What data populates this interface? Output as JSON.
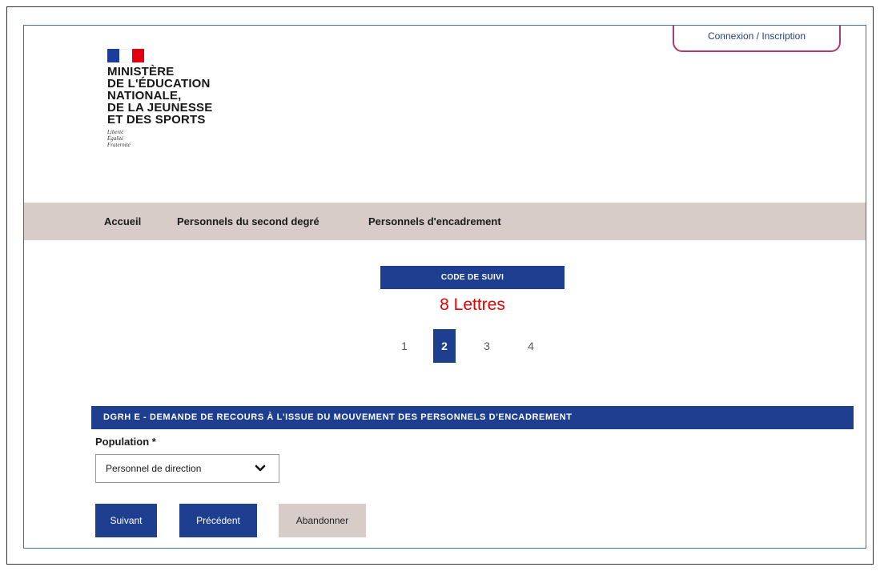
{
  "header": {
    "login_label": "Connexion / Inscription",
    "ministry_lines": [
      "MINISTÈRE",
      "DE L'ÉDUCATION",
      "NATIONALE,",
      "DE LA JEUNESSE",
      "ET DES SPORTS"
    ],
    "motto_lines": [
      "Liberté",
      "Égalité",
      "Fraternité"
    ],
    "flag_colors": {
      "blue": "#1b3d9c",
      "white": "#ffffff",
      "red": "#e1000f"
    }
  },
  "nav": {
    "items": [
      {
        "label": "Accueil"
      },
      {
        "label": "Personnels du second degré"
      },
      {
        "label": "Personnels d'encadrement"
      }
    ]
  },
  "tracking": {
    "label": "CODE DE SUIVI",
    "note": "8 Lettres"
  },
  "stepper": {
    "steps": [
      "1",
      "2",
      "3",
      "4"
    ],
    "active_step": "2"
  },
  "form": {
    "section_title": "DGRH E - DEMANDE DE RECOURS À L'ISSUE DU MOUVEMENT DES PERSONNELS D'ENCADREMENT",
    "population_label": "Population *",
    "population_value": "Personnel de direction"
  },
  "actions": {
    "next_label": "Suivant",
    "previous_label": "Précédent",
    "abandon_label": "Abandonner"
  },
  "colors": {
    "primary": "#1e3f8f",
    "nav_background": "#d8ccc8",
    "accent_red": "#e60000",
    "login_border": "#b03a6e"
  }
}
